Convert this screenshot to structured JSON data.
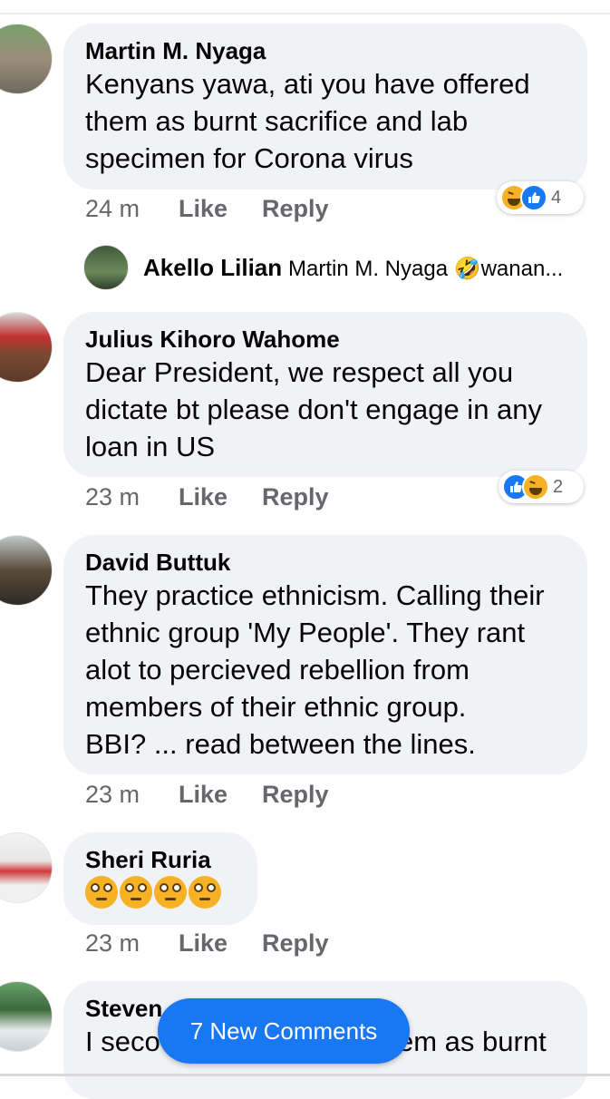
{
  "comments": [
    {
      "author": "Martin M. Nyaga",
      "lines": [
        "Kenyans yawa, ati you have offered",
        "them as burnt sacrifice and lab",
        "specimen for Corona virus"
      ],
      "time": "24 m",
      "like": "Like",
      "reply": "Reply",
      "reaction_count": "4"
    },
    {
      "author": "Julius Kihoro Wahome",
      "lines": [
        "Dear President, we respect all you",
        "dictate bt please don't engage in any",
        "loan in US"
      ],
      "time": "23 m",
      "like": "Like",
      "reply": "Reply",
      "reaction_count": "2"
    },
    {
      "author": "David Buttuk",
      "lines": [
        "They practice ethnicism. Calling their",
        "ethnic group 'My People'. They rant",
        "alot to percieved rebellion from",
        "members of their ethnic group.",
        "BBI? ... read between the lines."
      ],
      "time": "23 m",
      "like": "Like",
      "reply": "Reply"
    },
    {
      "author": "Sheri Ruria",
      "emoji": "rolling-eyes-x4",
      "time": "23 m",
      "like": "Like",
      "reply": "Reply"
    },
    {
      "author": "Steven",
      "lines": [
        "I seco",
        "em as burnt"
      ]
    }
  ],
  "reply_preview": {
    "author": "Akello Lilian",
    "text": "Martin M. Nyaga 🤣wanan..."
  },
  "new_comments_pill": "7 New Comments",
  "colors": {
    "bubble": "#f0f2f5",
    "meta": "#65676b",
    "accent": "#1877f2",
    "haha": "#f7b125"
  }
}
